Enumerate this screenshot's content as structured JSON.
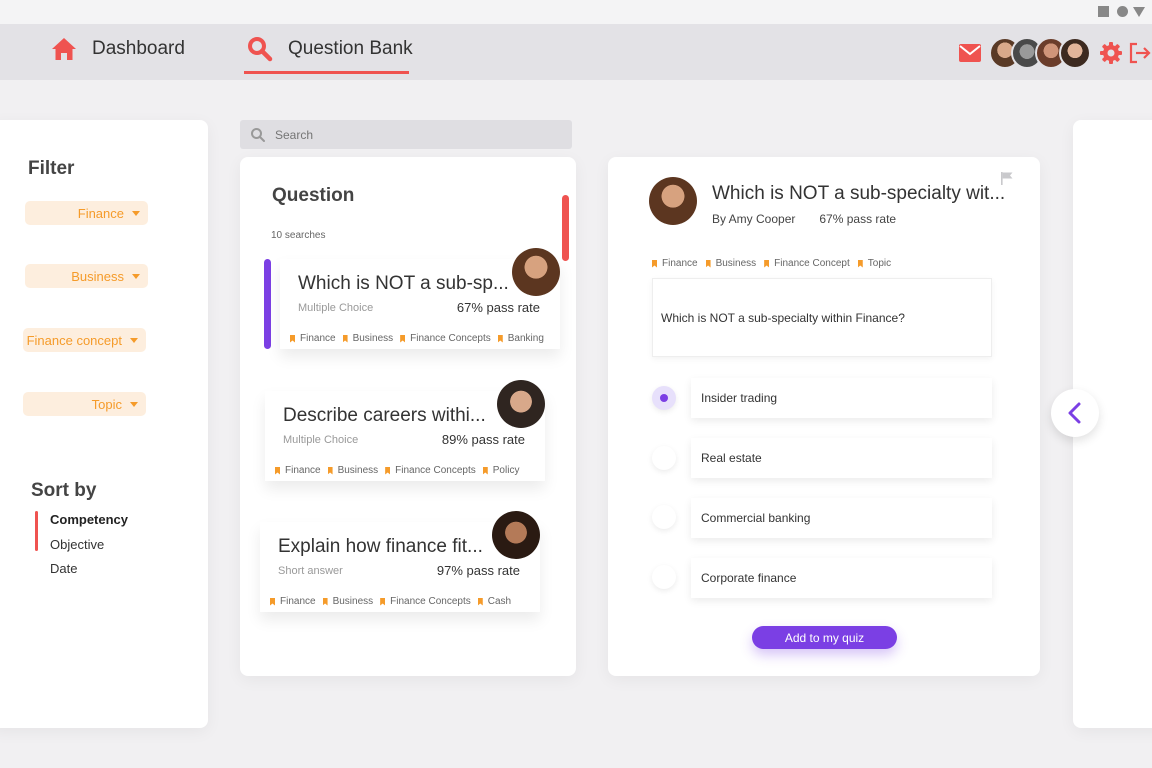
{
  "nav": {
    "dashboard_label": "Dashboard",
    "question_bank_label": "Question Bank",
    "accent_color": "#ef5350",
    "dashboard_icon": "home-icon",
    "question_bank_icon": "search-icon",
    "right_icons": [
      "mail-icon",
      "avatar",
      "avatar",
      "avatar",
      "avatar",
      "gear-icon",
      "logout-icon"
    ]
  },
  "filter": {
    "title": "Filter",
    "chips": [
      "Finance",
      "Business",
      "Finance concept",
      "Topic"
    ]
  },
  "sort": {
    "title": "Sort by",
    "items": [
      "Competency",
      "Objective",
      "Date"
    ],
    "active": "Competency"
  },
  "search": {
    "placeholder": "Search"
  },
  "questions": {
    "title": "Question",
    "count": "10 searches",
    "cards": [
      {
        "text": "Which is NOT a sub-sp...",
        "type": "Multiple Choice",
        "rate": "67% pass rate",
        "tags": [
          "Finance",
          "Business",
          "Finance Concepts",
          "Banking"
        ]
      },
      {
        "text": "Describe careers withi...",
        "type": "Multiple Choice",
        "rate": "89% pass rate",
        "tags": [
          "Finance",
          "Business",
          "Finance Concepts",
          "Policy"
        ]
      },
      {
        "text": "Explain how finance fit...",
        "type": "Short answer",
        "rate": "97% pass rate",
        "tags": [
          "Finance",
          "Business",
          "Finance Concepts",
          "Cash"
        ]
      }
    ]
  },
  "detail": {
    "title": "Which is NOT a sub-specialty wit...",
    "author": "By Amy Cooper",
    "rate": "67% pass rate",
    "tags": [
      "Finance",
      "Business",
      "Finance Concept",
      "Topic"
    ],
    "question": "Which is NOT a sub-specialty within Finance?",
    "options": [
      "Insider trading",
      "Real estate",
      "Commercial banking",
      "Corporate finance"
    ],
    "selected_option": "Insider trading",
    "add_button": "Add to my quiz",
    "primary_color": "#7b3fe4",
    "tag_color": "#f59b2a"
  }
}
